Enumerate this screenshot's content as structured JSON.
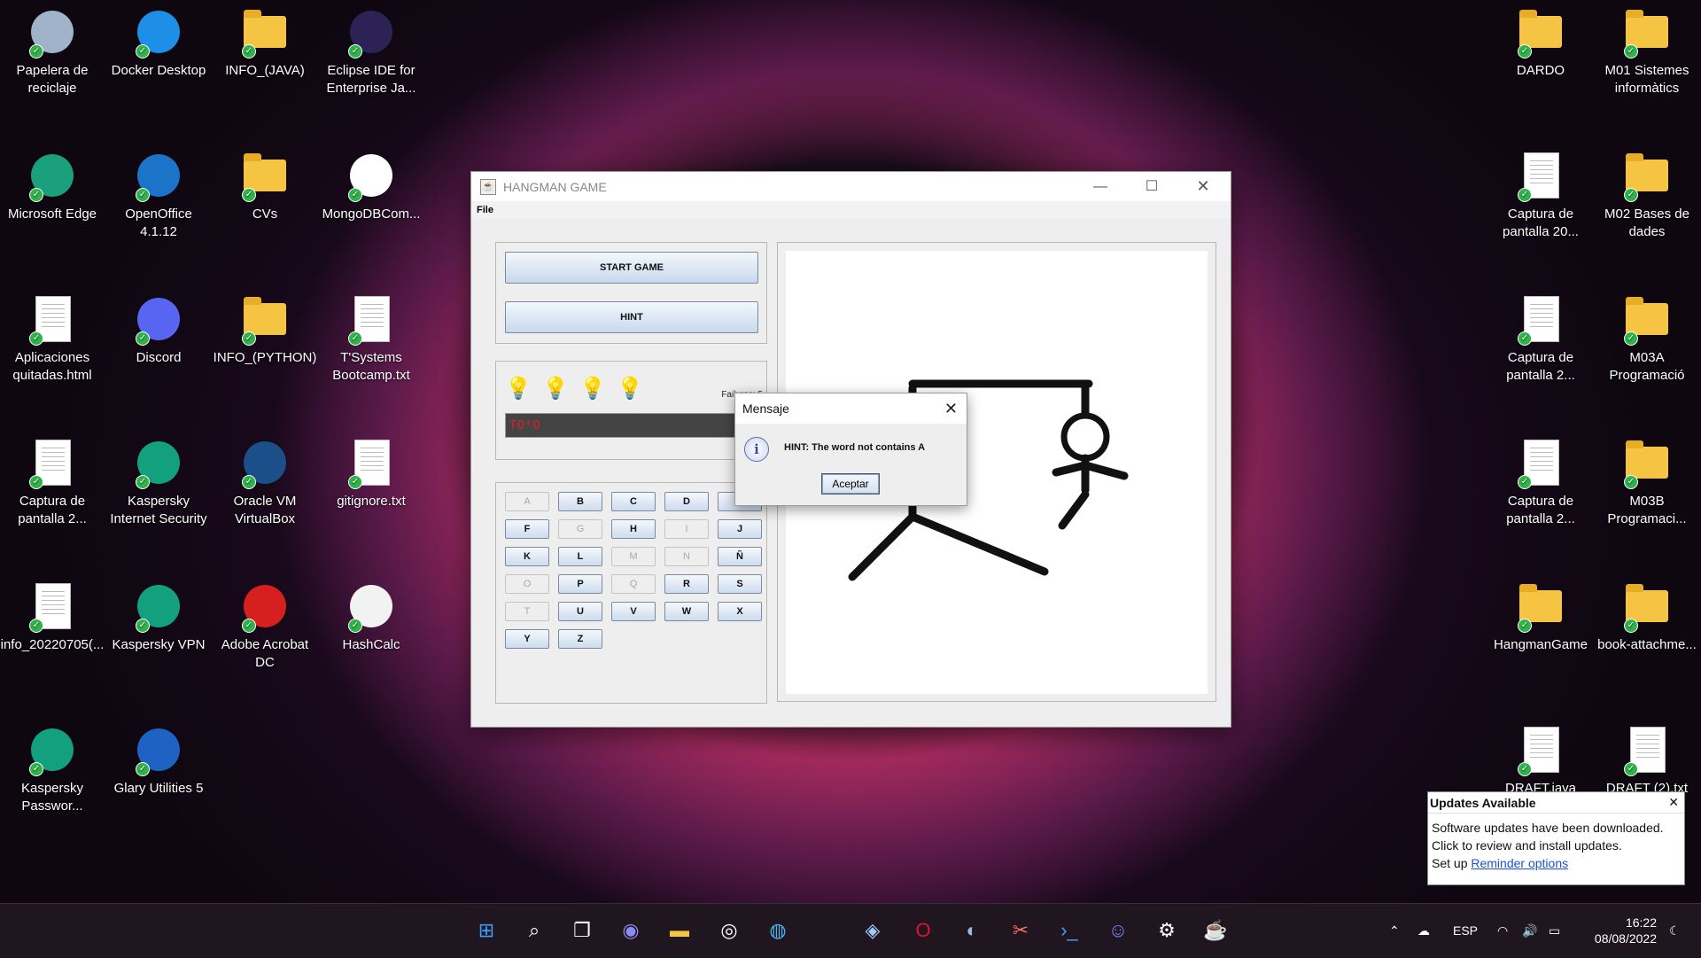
{
  "desktop": {
    "icons_left": [
      {
        "label": "Papelera de reciclaje",
        "icon": "recycle-bin-icon"
      },
      {
        "label": "Docker Desktop",
        "icon": "docker-icon"
      },
      {
        "label": "INFO_(JAVA)",
        "icon": "folder-icon"
      },
      {
        "label": "Eclipse IDE for Enterprise Ja...",
        "icon": "eclipse-icon"
      },
      {
        "label": "Microsoft Edge",
        "icon": "edge-icon"
      },
      {
        "label": "OpenOffice 4.1.12",
        "icon": "openoffice-icon"
      },
      {
        "label": "CVs",
        "icon": "folder-icon"
      },
      {
        "label": "MongoDBCom...",
        "icon": "mongodb-icon"
      },
      {
        "label": "Aplicaciones quitadas.html",
        "icon": "html-file-icon"
      },
      {
        "label": "Discord",
        "icon": "discord-icon"
      },
      {
        "label": "INFO_(PYTHON)",
        "icon": "folder-icon"
      },
      {
        "label": "T'Systems Bootcamp.txt",
        "icon": "text-file-icon"
      },
      {
        "label": "Captura de pantalla 2...",
        "icon": "image-file-icon"
      },
      {
        "label": "Kaspersky Internet Security",
        "icon": "kaspersky-icon"
      },
      {
        "label": "Oracle VM VirtualBox",
        "icon": "virtualbox-icon"
      },
      {
        "label": "gitignore.txt",
        "icon": "text-file-icon"
      },
      {
        "label": "info_20220705(...",
        "icon": "text-file-icon"
      },
      {
        "label": "Kaspersky VPN",
        "icon": "kaspersky-vpn-icon"
      },
      {
        "label": "Adobe Acrobat DC",
        "icon": "acrobat-icon"
      },
      {
        "label": "HashCalc",
        "icon": "hashcalc-icon"
      },
      {
        "label": "Kaspersky Passwor...",
        "icon": "kaspersky-password-icon"
      },
      {
        "label": "Glary Utilities 5",
        "icon": "glary-icon"
      }
    ],
    "icons_right": [
      {
        "label": "DARDO",
        "icon": "folder-icon"
      },
      {
        "label": "M01 Sistemes informàtics",
        "icon": "folder-icon"
      },
      {
        "label": "Captura de pantalla 20...",
        "icon": "image-file-icon"
      },
      {
        "label": "M02 Bases de dades",
        "icon": "folder-icon"
      },
      {
        "label": "Captura de pantalla 2...",
        "icon": "image-file-icon"
      },
      {
        "label": "M03A Programació",
        "icon": "folder-icon"
      },
      {
        "label": "Captura de pantalla 2...",
        "icon": "image-file-icon"
      },
      {
        "label": "M03B Programaci...",
        "icon": "folder-icon"
      },
      {
        "label": "HangmanGame",
        "icon": "folder-icon"
      },
      {
        "label": "book-attachme...",
        "icon": "folder-icon"
      },
      {
        "label": "DRAFT.java",
        "icon": "text-file-icon"
      },
      {
        "label": "DRAFT (2).txt",
        "icon": "text-file-icon"
      }
    ]
  },
  "app": {
    "title": "HANGMAN GAME",
    "menu_file": "File",
    "start_label": "START GAME",
    "hint_label": "HINT",
    "failures_label": "Failures: 5",
    "word_display": "TO*O",
    "hints_remaining": 4,
    "keys": [
      {
        "l": "A",
        "on": false
      },
      {
        "l": "B",
        "on": true
      },
      {
        "l": "C",
        "on": true
      },
      {
        "l": "D",
        "on": true
      },
      {
        "l": "E",
        "on": true
      },
      {
        "l": "F",
        "on": true
      },
      {
        "l": "G",
        "on": false
      },
      {
        "l": "H",
        "on": true
      },
      {
        "l": "I",
        "on": false
      },
      {
        "l": "J",
        "on": true
      },
      {
        "l": "K",
        "on": true
      },
      {
        "l": "L",
        "on": true
      },
      {
        "l": "M",
        "on": false
      },
      {
        "l": "N",
        "on": false
      },
      {
        "l": "Ñ",
        "on": true
      },
      {
        "l": "O",
        "on": false
      },
      {
        "l": "P",
        "on": true
      },
      {
        "l": "Q",
        "on": false
      },
      {
        "l": "R",
        "on": true
      },
      {
        "l": "S",
        "on": true
      },
      {
        "l": "T",
        "on": false
      },
      {
        "l": "U",
        "on": true
      },
      {
        "l": "V",
        "on": true
      },
      {
        "l": "W",
        "on": true
      },
      {
        "l": "X",
        "on": true
      },
      {
        "l": "Y",
        "on": true
      },
      {
        "l": "Z",
        "on": true
      }
    ]
  },
  "dialog": {
    "title": "Mensaje",
    "message": "HINT: The word not contains A",
    "button": "Aceptar"
  },
  "toast": {
    "title": "Updates Available",
    "body": "Software updates have been downloaded. Click to review and install updates.",
    "setup_text": "Set up",
    "link": "Reminder options"
  },
  "taskbar": {
    "language": "ESP",
    "time": "16:22",
    "date": "08/08/2022",
    "apps": [
      "start-icon",
      "search-icon",
      "task-view-icon",
      "chat-icon",
      "file-explorer-icon",
      "camera-icon",
      "browser-icon",
      "virtualbox-icon",
      "opera-icon",
      "eclipse-icon",
      "snipping-tool-icon",
      "terminal-icon",
      "discord-icon",
      "settings-icon",
      "java-icon"
    ]
  },
  "colors": {
    "accent": "#1a4fd6",
    "word_text": "#e02020"
  }
}
